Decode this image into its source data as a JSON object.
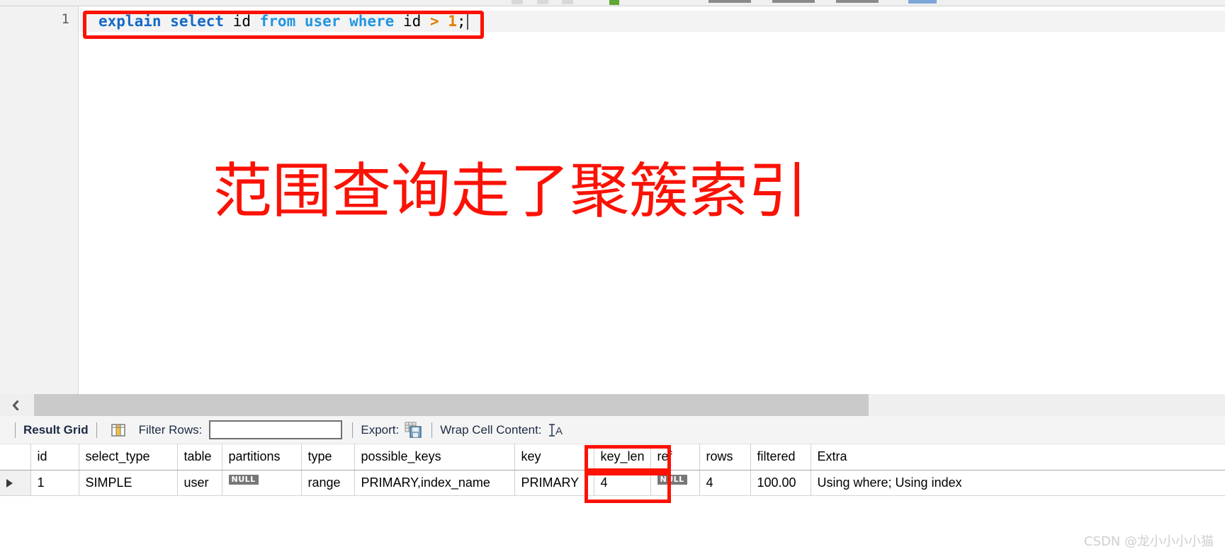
{
  "toolbar": {
    "icons": [
      {
        "name": "run-sql-icon",
        "color": "light"
      },
      {
        "name": "run-statement-icon",
        "color": "light"
      },
      {
        "name": "stop-icon",
        "color": "light"
      },
      {
        "name": "toggle-explain-icon",
        "color": "green"
      },
      {
        "name": "commit-icon",
        "color": "dark"
      },
      {
        "name": "rollback-icon",
        "color": "dark"
      },
      {
        "name": "autocommit-icon",
        "color": "dark"
      },
      {
        "name": "toggle-panel-icon",
        "color": "blue"
      }
    ]
  },
  "editor": {
    "line_number": "1",
    "sql_tokens": [
      {
        "text": "explain",
        "type": "kw"
      },
      {
        "text": " ",
        "type": "punc"
      },
      {
        "text": "select",
        "type": "kw"
      },
      {
        "text": " ",
        "type": "punc"
      },
      {
        "text": "id",
        "type": "ident"
      },
      {
        "text": " ",
        "type": "punc"
      },
      {
        "text": "from",
        "type": "kw2"
      },
      {
        "text": " ",
        "type": "punc"
      },
      {
        "text": "user",
        "type": "kw2"
      },
      {
        "text": " ",
        "type": "punc"
      },
      {
        "text": "where",
        "type": "kw2"
      },
      {
        "text": " ",
        "type": "punc"
      },
      {
        "text": "id",
        "type": "ident"
      },
      {
        "text": " ",
        "type": "punc"
      },
      {
        "text": ">",
        "type": "op"
      },
      {
        "text": " ",
        "type": "punc"
      },
      {
        "text": "1",
        "type": "num"
      },
      {
        "text": ";",
        "type": "punc"
      }
    ],
    "sql_plain": "explain select id from user where id > 1;"
  },
  "annotation": {
    "text": "范围查询走了聚簇索引",
    "color": "#fb1205"
  },
  "grid_toolbar": {
    "result_grid_label": "Result Grid",
    "grid_icon": "grid-icon",
    "filter_rows_label": "Filter Rows:",
    "filter_rows_value": "",
    "filter_rows_placeholder": "",
    "export_label": "Export:",
    "export_icon": "export-save-icon",
    "wrap_cell_label": "Wrap Cell Content:",
    "wrap_cell_icon": "wrap-text-icon"
  },
  "results": {
    "columns": [
      "id",
      "select_type",
      "table",
      "partitions",
      "type",
      "possible_keys",
      "key",
      "key_len",
      "ref",
      "rows",
      "filtered",
      "Extra"
    ],
    "rows": [
      {
        "marker": "row-selected-arrow",
        "id": "1",
        "select_type": "SIMPLE",
        "table": "user",
        "partitions": "NULL",
        "type": "range",
        "possible_keys": "PRIMARY,index_name",
        "key": "PRIMARY",
        "key_len": "4",
        "ref": "NULL",
        "rows": "4",
        "filtered": "100.00",
        "Extra": "Using where; Using index"
      }
    ],
    "null_label": "NULL",
    "highlight_color": "#fb1204"
  },
  "scrollbar": {
    "left_arrow_icon": "chevron-left-icon"
  },
  "watermark": {
    "text": "CSDN @龙小小小小猫"
  }
}
